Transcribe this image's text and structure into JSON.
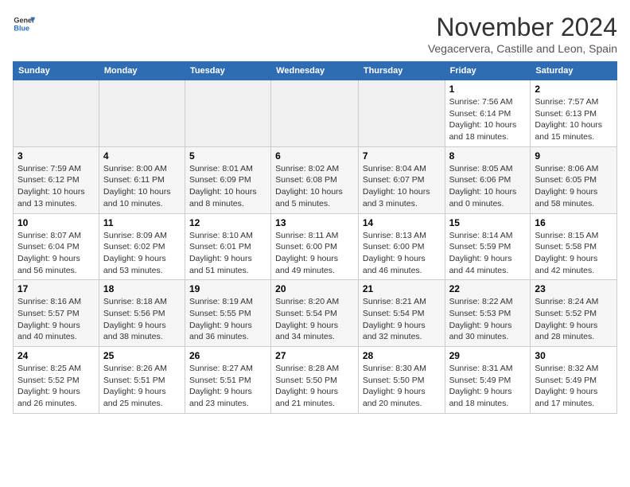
{
  "logo": {
    "line1": "General",
    "line2": "Blue"
  },
  "title": "November 2024",
  "location": "Vegacervera, Castille and Leon, Spain",
  "days_of_week": [
    "Sunday",
    "Monday",
    "Tuesday",
    "Wednesday",
    "Thursday",
    "Friday",
    "Saturday"
  ],
  "weeks": [
    [
      {
        "day": "",
        "info": ""
      },
      {
        "day": "",
        "info": ""
      },
      {
        "day": "",
        "info": ""
      },
      {
        "day": "",
        "info": ""
      },
      {
        "day": "",
        "info": ""
      },
      {
        "day": "1",
        "info": "Sunrise: 7:56 AM\nSunset: 6:14 PM\nDaylight: 10 hours and 18 minutes."
      },
      {
        "day": "2",
        "info": "Sunrise: 7:57 AM\nSunset: 6:13 PM\nDaylight: 10 hours and 15 minutes."
      }
    ],
    [
      {
        "day": "3",
        "info": "Sunrise: 7:59 AM\nSunset: 6:12 PM\nDaylight: 10 hours and 13 minutes."
      },
      {
        "day": "4",
        "info": "Sunrise: 8:00 AM\nSunset: 6:11 PM\nDaylight: 10 hours and 10 minutes."
      },
      {
        "day": "5",
        "info": "Sunrise: 8:01 AM\nSunset: 6:09 PM\nDaylight: 10 hours and 8 minutes."
      },
      {
        "day": "6",
        "info": "Sunrise: 8:02 AM\nSunset: 6:08 PM\nDaylight: 10 hours and 5 minutes."
      },
      {
        "day": "7",
        "info": "Sunrise: 8:04 AM\nSunset: 6:07 PM\nDaylight: 10 hours and 3 minutes."
      },
      {
        "day": "8",
        "info": "Sunrise: 8:05 AM\nSunset: 6:06 PM\nDaylight: 10 hours and 0 minutes."
      },
      {
        "day": "9",
        "info": "Sunrise: 8:06 AM\nSunset: 6:05 PM\nDaylight: 9 hours and 58 minutes."
      }
    ],
    [
      {
        "day": "10",
        "info": "Sunrise: 8:07 AM\nSunset: 6:04 PM\nDaylight: 9 hours and 56 minutes."
      },
      {
        "day": "11",
        "info": "Sunrise: 8:09 AM\nSunset: 6:02 PM\nDaylight: 9 hours and 53 minutes."
      },
      {
        "day": "12",
        "info": "Sunrise: 8:10 AM\nSunset: 6:01 PM\nDaylight: 9 hours and 51 minutes."
      },
      {
        "day": "13",
        "info": "Sunrise: 8:11 AM\nSunset: 6:00 PM\nDaylight: 9 hours and 49 minutes."
      },
      {
        "day": "14",
        "info": "Sunrise: 8:13 AM\nSunset: 6:00 PM\nDaylight: 9 hours and 46 minutes."
      },
      {
        "day": "15",
        "info": "Sunrise: 8:14 AM\nSunset: 5:59 PM\nDaylight: 9 hours and 44 minutes."
      },
      {
        "day": "16",
        "info": "Sunrise: 8:15 AM\nSunset: 5:58 PM\nDaylight: 9 hours and 42 minutes."
      }
    ],
    [
      {
        "day": "17",
        "info": "Sunrise: 8:16 AM\nSunset: 5:57 PM\nDaylight: 9 hours and 40 minutes."
      },
      {
        "day": "18",
        "info": "Sunrise: 8:18 AM\nSunset: 5:56 PM\nDaylight: 9 hours and 38 minutes."
      },
      {
        "day": "19",
        "info": "Sunrise: 8:19 AM\nSunset: 5:55 PM\nDaylight: 9 hours and 36 minutes."
      },
      {
        "day": "20",
        "info": "Sunrise: 8:20 AM\nSunset: 5:54 PM\nDaylight: 9 hours and 34 minutes."
      },
      {
        "day": "21",
        "info": "Sunrise: 8:21 AM\nSunset: 5:54 PM\nDaylight: 9 hours and 32 minutes."
      },
      {
        "day": "22",
        "info": "Sunrise: 8:22 AM\nSunset: 5:53 PM\nDaylight: 9 hours and 30 minutes."
      },
      {
        "day": "23",
        "info": "Sunrise: 8:24 AM\nSunset: 5:52 PM\nDaylight: 9 hours and 28 minutes."
      }
    ],
    [
      {
        "day": "24",
        "info": "Sunrise: 8:25 AM\nSunset: 5:52 PM\nDaylight: 9 hours and 26 minutes."
      },
      {
        "day": "25",
        "info": "Sunrise: 8:26 AM\nSunset: 5:51 PM\nDaylight: 9 hours and 25 minutes."
      },
      {
        "day": "26",
        "info": "Sunrise: 8:27 AM\nSunset: 5:51 PM\nDaylight: 9 hours and 23 minutes."
      },
      {
        "day": "27",
        "info": "Sunrise: 8:28 AM\nSunset: 5:50 PM\nDaylight: 9 hours and 21 minutes."
      },
      {
        "day": "28",
        "info": "Sunrise: 8:30 AM\nSunset: 5:50 PM\nDaylight: 9 hours and 20 minutes."
      },
      {
        "day": "29",
        "info": "Sunrise: 8:31 AM\nSunset: 5:49 PM\nDaylight: 9 hours and 18 minutes."
      },
      {
        "day": "30",
        "info": "Sunrise: 8:32 AM\nSunset: 5:49 PM\nDaylight: 9 hours and 17 minutes."
      }
    ]
  ]
}
